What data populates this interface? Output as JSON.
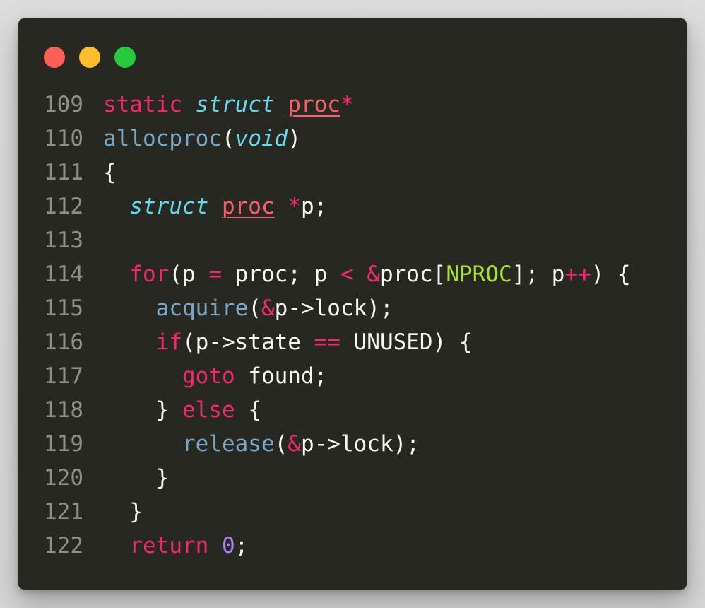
{
  "window": {
    "controls": {
      "close_color": "#ff5f56",
      "minimize_color": "#ffbd2e",
      "zoom_color": "#27c93f"
    }
  },
  "code": {
    "lines": [
      {
        "number": "109",
        "tokens": [
          {
            "t": "static",
            "c": "kw"
          },
          {
            "t": " ",
            "c": "src"
          },
          {
            "t": "struct",
            "c": "ty"
          },
          {
            "t": " ",
            "c": "src"
          },
          {
            "t": "proc",
            "c": "cls"
          },
          {
            "t": "*",
            "c": "op"
          }
        ]
      },
      {
        "number": "110",
        "tokens": [
          {
            "t": "allocproc",
            "c": "fn"
          },
          {
            "t": "(",
            "c": "src"
          },
          {
            "t": "void",
            "c": "ty"
          },
          {
            "t": ")",
            "c": "src"
          }
        ]
      },
      {
        "number": "111",
        "tokens": [
          {
            "t": "{",
            "c": "src"
          }
        ]
      },
      {
        "number": "112",
        "tokens": [
          {
            "t": "  ",
            "c": "src"
          },
          {
            "t": "struct",
            "c": "ty"
          },
          {
            "t": " ",
            "c": "src"
          },
          {
            "t": "proc",
            "c": "cls"
          },
          {
            "t": " ",
            "c": "src"
          },
          {
            "t": "*",
            "c": "op"
          },
          {
            "t": "p;",
            "c": "src"
          }
        ]
      },
      {
        "number": "113",
        "tokens": []
      },
      {
        "number": "114",
        "tokens": [
          {
            "t": "  ",
            "c": "src"
          },
          {
            "t": "for",
            "c": "kw"
          },
          {
            "t": "(p ",
            "c": "src"
          },
          {
            "t": "=",
            "c": "op"
          },
          {
            "t": " proc; p ",
            "c": "src"
          },
          {
            "t": "<",
            "c": "op"
          },
          {
            "t": " ",
            "c": "src"
          },
          {
            "t": "&",
            "c": "op"
          },
          {
            "t": "proc[",
            "c": "src"
          },
          {
            "t": "NPROC",
            "c": "cst"
          },
          {
            "t": "]; p",
            "c": "src"
          },
          {
            "t": "++",
            "c": "op"
          },
          {
            "t": ") {",
            "c": "src"
          }
        ]
      },
      {
        "number": "115",
        "tokens": [
          {
            "t": "    ",
            "c": "src"
          },
          {
            "t": "acquire",
            "c": "fn"
          },
          {
            "t": "(",
            "c": "src"
          },
          {
            "t": "&",
            "c": "op"
          },
          {
            "t": "p->lock);",
            "c": "src"
          }
        ]
      },
      {
        "number": "116",
        "tokens": [
          {
            "t": "    ",
            "c": "src"
          },
          {
            "t": "if",
            "c": "kw"
          },
          {
            "t": "(p->state ",
            "c": "src"
          },
          {
            "t": "==",
            "c": "op"
          },
          {
            "t": " UNUSED) {",
            "c": "src"
          }
        ]
      },
      {
        "number": "117",
        "tokens": [
          {
            "t": "      ",
            "c": "src"
          },
          {
            "t": "goto",
            "c": "kw"
          },
          {
            "t": " found;",
            "c": "src"
          }
        ]
      },
      {
        "number": "118",
        "tokens": [
          {
            "t": "    } ",
            "c": "src"
          },
          {
            "t": "else",
            "c": "kw"
          },
          {
            "t": " {",
            "c": "src"
          }
        ]
      },
      {
        "number": "119",
        "tokens": [
          {
            "t": "      ",
            "c": "src"
          },
          {
            "t": "release",
            "c": "fn"
          },
          {
            "t": "(",
            "c": "src"
          },
          {
            "t": "&",
            "c": "op"
          },
          {
            "t": "p->lock);",
            "c": "src"
          }
        ]
      },
      {
        "number": "120",
        "tokens": [
          {
            "t": "    }",
            "c": "src"
          }
        ]
      },
      {
        "number": "121",
        "tokens": [
          {
            "t": "  }",
            "c": "src"
          }
        ]
      },
      {
        "number": "122",
        "tokens": [
          {
            "t": "  ",
            "c": "src"
          },
          {
            "t": "return",
            "c": "kw"
          },
          {
            "t": " ",
            "c": "src"
          },
          {
            "t": "0",
            "c": "num"
          },
          {
            "t": ";",
            "c": "src"
          }
        ]
      }
    ]
  }
}
